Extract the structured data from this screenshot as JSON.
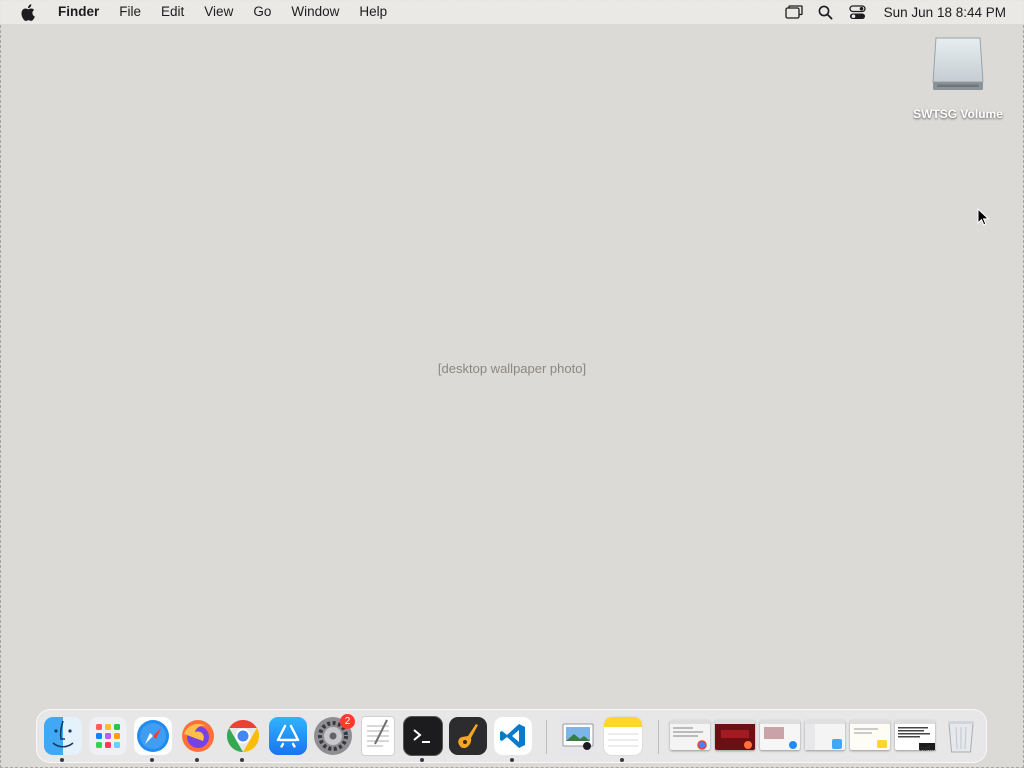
{
  "menubar": {
    "app_name": "Finder",
    "menus": [
      "File",
      "Edit",
      "View",
      "Go",
      "Window",
      "Help"
    ],
    "clock": "Sun Jun 18  8:44 PM",
    "status_icons": [
      "screen-mirroring-icon",
      "spotlight-search-icon",
      "control-center-icon"
    ]
  },
  "desktop": {
    "volume_label": "SWTSG Volume",
    "wallpaper_caption": "[desktop wallpaper photo]"
  },
  "dock": {
    "apps": [
      {
        "name": "finder-icon",
        "running": true
      },
      {
        "name": "launchpad-icon",
        "running": false
      },
      {
        "name": "safari-icon",
        "running": true
      },
      {
        "name": "firefox-icon",
        "running": true
      },
      {
        "name": "chrome-icon",
        "running": true
      },
      {
        "name": "app-store-icon",
        "running": false
      },
      {
        "name": "system-settings-icon",
        "running": false,
        "badge": "2"
      },
      {
        "name": "textedit-icon",
        "running": false
      },
      {
        "name": "terminal-icon",
        "running": true
      },
      {
        "name": "garageband-icon",
        "running": false
      },
      {
        "name": "vscode-icon",
        "running": true
      },
      {
        "name": "preview-icon",
        "running": false
      },
      {
        "name": "notes-icon",
        "running": true
      }
    ],
    "minimized_windows": [
      {
        "name": "chrome-window-thumbnail"
      },
      {
        "name": "firefox-window-thumbnail"
      },
      {
        "name": "safari-window-thumbnail"
      },
      {
        "name": "finder-window-thumbnail"
      },
      {
        "name": "notes-window-thumbnail"
      },
      {
        "name": "terminal-window-thumbnail",
        "label": "curl..."
      }
    ],
    "trash_label": "trash-icon"
  },
  "colors": {
    "menubar_bg": "#eceae7",
    "dock_bg": "#ebebee",
    "badge_red": "#ff3b30"
  }
}
